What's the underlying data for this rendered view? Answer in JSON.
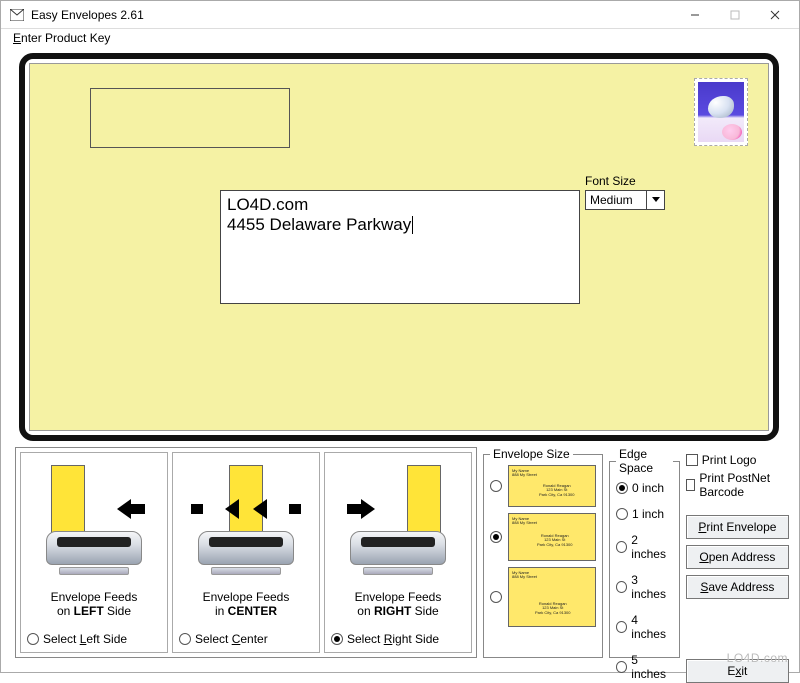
{
  "window": {
    "title": "Easy Envelopes 2.61",
    "menu_item_html": "<u>E</u>nter Product Key"
  },
  "envelope": {
    "address_line1": "LO4D.com",
    "address_line2": "4455 Delaware Parkway",
    "font_size_label": "Font Size",
    "font_size_value": "Medium"
  },
  "feed": {
    "caption_left_html": "Envelope Feeds<br>on <b>LEFT</b> Side",
    "caption_center_html": "Envelope Feeds<br>in <b>CENTER</b>",
    "caption_right_html": "Envelope Feeds<br>on <b>RIGHT</b> Side",
    "radio_left_html": "Select <u>L</u>eft Side",
    "radio_center_html": "Select <u>C</u>enter",
    "radio_right_html": "Select <u>R</u>ight Side",
    "selected": "right"
  },
  "envelope_size": {
    "legend": "Envelope Size",
    "selected_index": 1,
    "thumb_return_html": "My Name<br>888 My Street",
    "thumb_return2_html": "My Name<br>888 My Street<br>",
    "dest1_html": "Ronald Reagan<br>123 Main St<br>Park City, Ca 91300",
    "dest2_html": "Ronald Reagan<br>123 Main St<br>Park City, Ca 91300",
    "dest3_html": "Ronald Reagan<br>123 Main St<br>Park City, Ca 91300"
  },
  "edge_space": {
    "legend": "Edge Space",
    "options": [
      "0 inch",
      "1 inch",
      "2 inches",
      "3 inches",
      "4 inches",
      "5 inches"
    ],
    "selected_index": 0
  },
  "right": {
    "print_logo": "Print Logo",
    "print_postnet": "Print PostNet Barcode",
    "btn_print_html": "<u>P</u>rint Envelope",
    "btn_open_html": "<u>O</u>pen Address",
    "btn_save_html": "<u>S</u>ave Address",
    "btn_exit_html": "E<u>x</u>it"
  },
  "watermark": "LO4D.com"
}
